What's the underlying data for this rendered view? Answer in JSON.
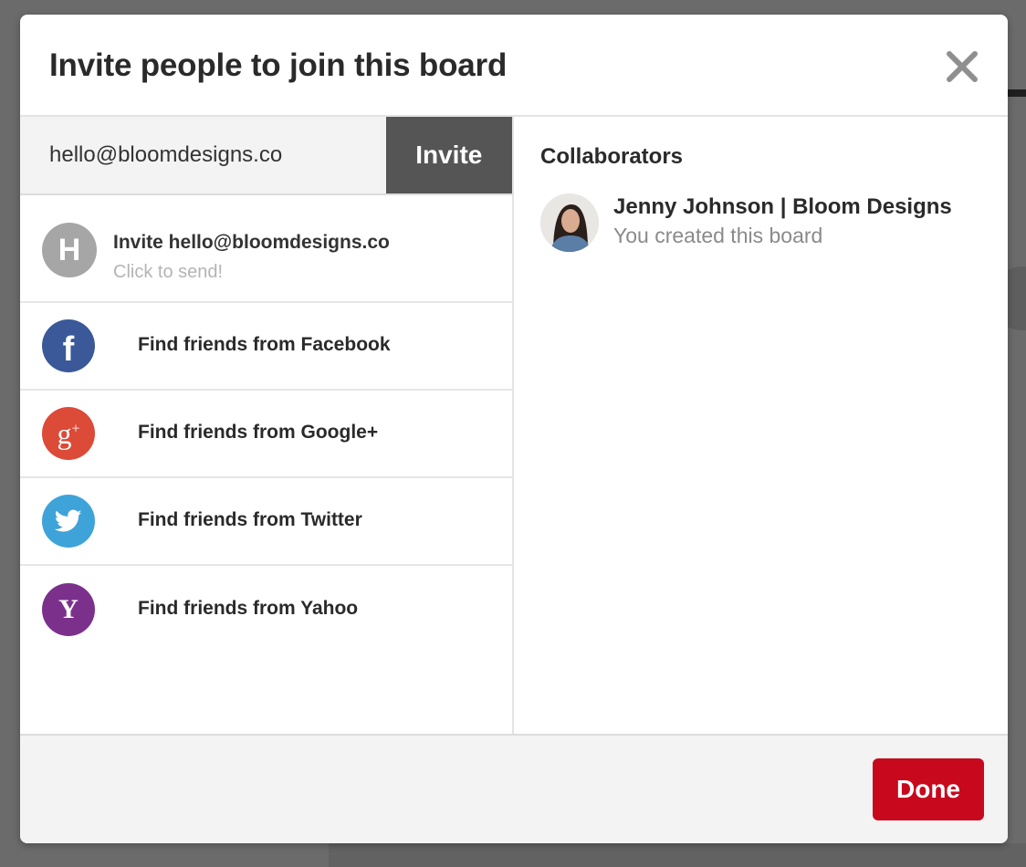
{
  "modal": {
    "title": "Invite people to join this board",
    "close_icon": "close-icon"
  },
  "invite": {
    "email_value": "hello@bloomdesigns.co",
    "button_label": "Invite"
  },
  "suggestions": {
    "invite_row": {
      "avatar_letter": "H",
      "line1": "Invite hello@bloomdesigns.co",
      "line2": "Click to send!"
    },
    "friends": [
      {
        "label": "Find friends from Facebook",
        "icon": "facebook-icon",
        "color": "#3b5998"
      },
      {
        "label": "Find friends from Google+",
        "icon": "google-plus-icon",
        "color": "#dc4a38"
      },
      {
        "label": "Find friends from Twitter",
        "icon": "twitter-icon",
        "color": "#3ea3d8"
      },
      {
        "label": "Find friends from Yahoo",
        "icon": "yahoo-icon",
        "color": "#7b318c"
      }
    ]
  },
  "collaborators": {
    "heading": "Collaborators",
    "items": [
      {
        "name": "Jenny Johnson | Bloom Designs",
        "subtitle": "You created this board"
      }
    ]
  },
  "footer": {
    "done_label": "Done",
    "done_color": "#c8081d"
  }
}
